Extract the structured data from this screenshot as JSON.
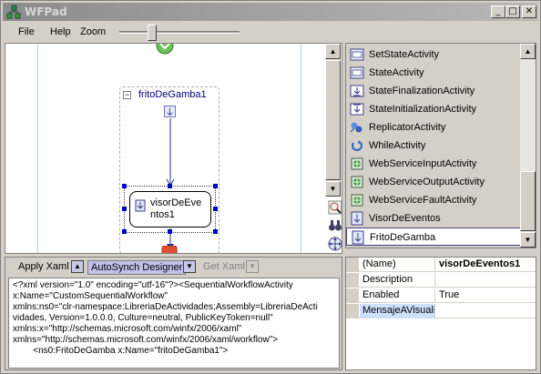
{
  "window": {
    "title": "WFPad",
    "minimize_glyph": "_",
    "maximize_glyph": "□",
    "close_glyph": "✕"
  },
  "menu": {
    "items": [
      "File",
      "Help",
      "Zoom"
    ]
  },
  "designer": {
    "sequence_label": "fritoDeGamba1",
    "activity_label": "visorDeEve\nntos1",
    "collapse_glyph": "−"
  },
  "toolbox": {
    "items": [
      {
        "label": "SetStateActivity",
        "icon": "state-icon"
      },
      {
        "label": "StateActivity",
        "icon": "state-icon"
      },
      {
        "label": "StateFinalizationActivity",
        "icon": "state-finalization-icon"
      },
      {
        "label": "StateInitializationActivity",
        "icon": "state-initialization-icon"
      },
      {
        "label": "ReplicatorActivity",
        "icon": "replicator-icon"
      },
      {
        "label": "WhileActivity",
        "icon": "while-loop-icon"
      },
      {
        "label": "WebServiceInputActivity",
        "icon": "web-service-icon"
      },
      {
        "label": "WebServiceOutputActivity",
        "icon": "web-service-icon"
      },
      {
        "label": "WebServiceFaultActivity",
        "icon": "web-service-icon"
      },
      {
        "label": "VisorDeEventos",
        "icon": "custom-activity-icon"
      },
      {
        "label": "FritoDeGamba",
        "icon": "custom-activity-icon"
      }
    ],
    "selected_index": 10
  },
  "xaml": {
    "apply_label": "Apply Xaml",
    "autosynch_label": "AutoSynch Designer",
    "get_label": "Get Xaml",
    "content": "<?xml version=\"1.0\" encoding=\"utf-16\"?><SequentialWorkflowActivity\nx:Name=\"CustomSequentialWorkflow\"\nxmlns:ns0=\"clr-namespace:LibreriaDeActividades;Assembly=LibreriaDeActi\nvidades, Version=1.0.0.0, Culture=neutral, PublicKeyToken=null\"\nxmlns:x=\"http://schemas.microsoft.com/winfx/2006/xaml\"\nxmlns=\"http://schemas.microsoft.com/winfx/2006/xaml/workflow\">\n        <ns0:FritoDeGamba x:Name=\"fritoDeGamba1\">"
  },
  "properties": {
    "rows": [
      {
        "name": "(Name)",
        "value": "visorDeEventos1",
        "bold": true
      },
      {
        "name": "Description",
        "value": ""
      },
      {
        "name": "Enabled",
        "value": "True"
      },
      {
        "name": "MensajeAVisualizar",
        "value": ""
      }
    ]
  },
  "colors": {
    "accent": "#0000c0",
    "window_bg": "#d4d0c8",
    "title_bar": "#9a9a9a"
  }
}
